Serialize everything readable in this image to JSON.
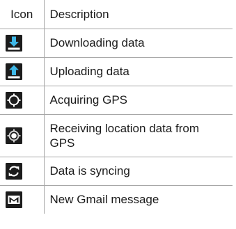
{
  "table": {
    "headers": {
      "icon": "Icon",
      "description": "Description"
    },
    "rows": [
      {
        "icon": "download-icon",
        "description": "Downloading data"
      },
      {
        "icon": "upload-icon",
        "description": "Uploading data"
      },
      {
        "icon": "gps-acquiring-icon",
        "description": "Acquiring GPS"
      },
      {
        "icon": "gps-receiving-icon",
        "description": "Receiving location data from GPS"
      },
      {
        "icon": "sync-icon",
        "description": "Data is syncing"
      },
      {
        "icon": "gmail-icon",
        "description": "New Gmail message"
      }
    ]
  },
  "colors": {
    "border": "#a7a7a7",
    "icon_background": "#1c1c1c",
    "icon_accent": "#3fb8e8",
    "icon_white": "#ffffff"
  }
}
